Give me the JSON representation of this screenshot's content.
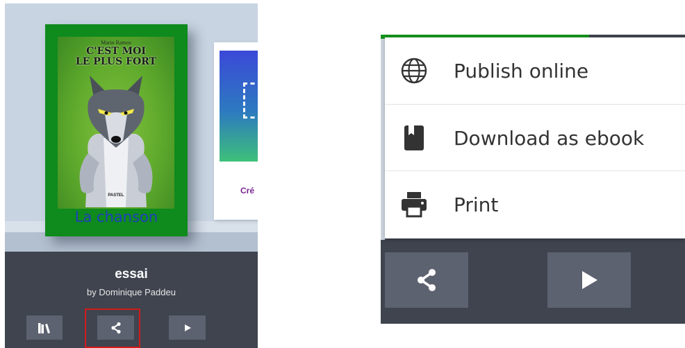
{
  "left": {
    "book": {
      "cover_author": "Mario Ramos",
      "cover_title_line1": "C'EST MOI",
      "cover_title_line2": "LE PLUS FORT",
      "cover_publisher": "PASTEL",
      "caption": "La chanson"
    },
    "second_book": {
      "label": "Cré"
    },
    "info": {
      "title": "essai",
      "author": "by Dominique Paddeu"
    },
    "buttons": [
      {
        "name": "library",
        "icon": "library-icon"
      },
      {
        "name": "share",
        "icon": "share-icon",
        "highlighted": true
      },
      {
        "name": "play",
        "icon": "play-icon"
      }
    ]
  },
  "right": {
    "menu": [
      {
        "icon": "globe-icon",
        "label": "Publish online"
      },
      {
        "icon": "book-icon",
        "label": "Download as ebook"
      },
      {
        "icon": "printer-icon",
        "label": "Print"
      }
    ],
    "buttons": [
      {
        "name": "share",
        "icon": "share-icon"
      },
      {
        "name": "play",
        "icon": "play-icon"
      }
    ]
  },
  "colors": {
    "shelf_background": "#c8d4e1",
    "info_bar": "#3f444f",
    "button": "#5d6270",
    "book_cover": "#0f8a1d",
    "caption_text": "#1f3fbf",
    "highlight": "#d11b1b",
    "menu_background": "#ffffff"
  }
}
